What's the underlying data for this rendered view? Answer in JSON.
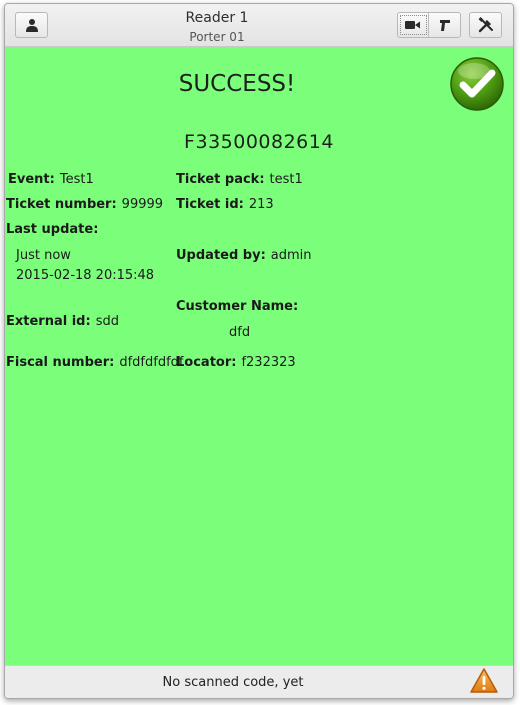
{
  "header": {
    "title": "Reader 1",
    "subtitle": "Porter 01",
    "user_icon": "user-icon",
    "camera_icon": "video-camera-icon",
    "scanner_icon": "barcode-scanner-icon",
    "tools_icon": "tools-icon"
  },
  "result": {
    "status": "SUCCESS!",
    "status_icon": "checkmark-icon",
    "code": "F33500082614",
    "background_color": "#7bff7b"
  },
  "ticket": {
    "event": {
      "label": "Event:",
      "value": "Test1"
    },
    "ticket_pack": {
      "label": "Ticket pack:",
      "value": "test1"
    },
    "ticket_number": {
      "label": "Ticket number:",
      "value": "99999"
    },
    "ticket_id": {
      "label": "Ticket id:",
      "value": "213"
    },
    "last_update": {
      "label": "Last update:",
      "relative": "Just now",
      "datetime": "2015-02-18 20:15:48"
    },
    "updated_by": {
      "label": "Updated by:",
      "value": "admin"
    },
    "customer_name": {
      "label": "Customer Name:",
      "value": "dfd"
    },
    "external_id": {
      "label": "External id:",
      "value": "sdd"
    },
    "fiscal_number": {
      "label": "Fiscal number:",
      "value": "dfdfdfdfdf"
    },
    "locator": {
      "label": "Locator:",
      "value": "f232323"
    }
  },
  "statusbar": {
    "text": "No scanned code, yet",
    "icon": "warning-icon",
    "icon_color": "#f0a030"
  }
}
